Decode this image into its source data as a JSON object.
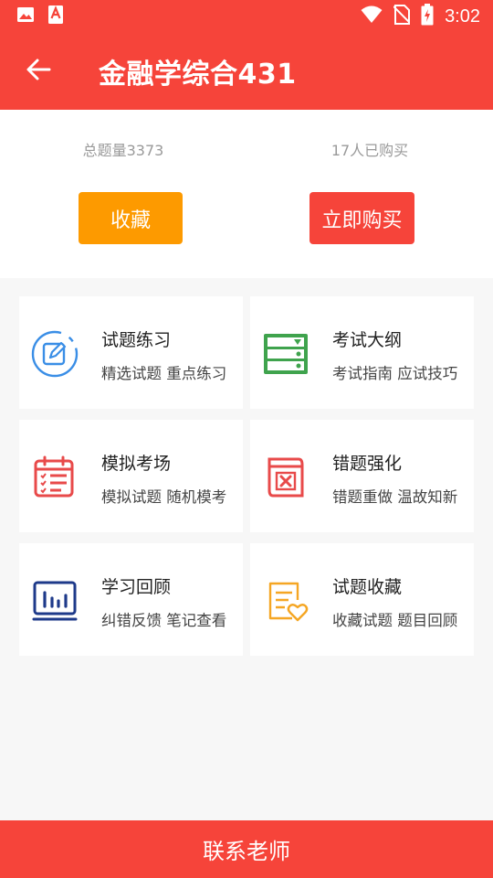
{
  "status_bar": {
    "time": "3:02"
  },
  "app_bar": {
    "title": "金融学综合431"
  },
  "summary": {
    "total_questions": "总题量3373",
    "buyers": "17人已购买",
    "favorite_button": "收藏",
    "buy_button": "立即购买"
  },
  "modules": [
    {
      "title": "试题练习",
      "subtitle": "精选试题 重点练习",
      "icon": "edit-circle-icon",
      "color": "#3a8ee6"
    },
    {
      "title": "考试大纲",
      "subtitle": "考试指南 应试技巧",
      "icon": "server-icon",
      "color": "#3fa34d"
    },
    {
      "title": "模拟考场",
      "subtitle": "模拟试题 随机模考",
      "icon": "calendar-checklist-icon",
      "color": "#e84a4a"
    },
    {
      "title": "错题强化",
      "subtitle": "错题重做 温故知新",
      "icon": "wrong-box-icon",
      "color": "#e84a4a"
    },
    {
      "title": "学习回顾",
      "subtitle": "纠错反馈 笔记查看",
      "icon": "bar-chart-icon",
      "color": "#1e3a8a"
    },
    {
      "title": "试题收藏",
      "subtitle": "收藏试题 题目回顾",
      "icon": "heart-note-icon",
      "color": "#f5a623"
    }
  ],
  "footer": {
    "contact_label": "联系老师"
  },
  "colors": {
    "primary": "#f6443a",
    "favorite": "#fd9a00"
  }
}
